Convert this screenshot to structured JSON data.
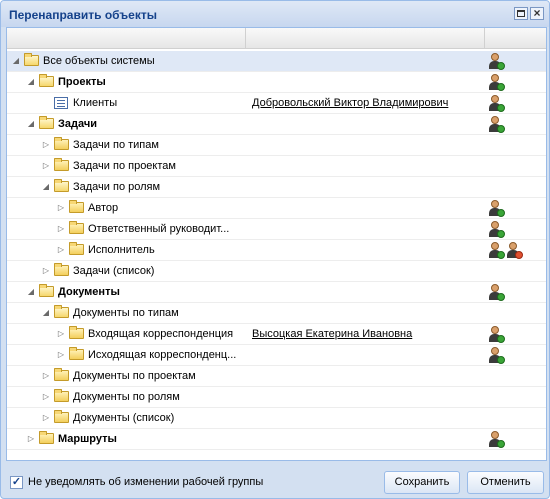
{
  "window": {
    "title": "Перенаправить объекты"
  },
  "tree": [
    {
      "label": "Все объекты системы",
      "bold": false,
      "arrow": "expanded",
      "icon": "folder-open",
      "level": 0,
      "selected": true,
      "users": [
        "add"
      ]
    },
    {
      "label": "Проекты",
      "bold": true,
      "arrow": "expanded",
      "icon": "folder-open",
      "level": 1,
      "users": [
        "add"
      ]
    },
    {
      "label": "Клиенты",
      "bold": false,
      "arrow": "none",
      "icon": "list",
      "level": 2,
      "link": "Добровольский Виктор Владимирович",
      "users": [
        "add"
      ]
    },
    {
      "label": "Задачи",
      "bold": true,
      "arrow": "expanded",
      "icon": "folder-open",
      "level": 1,
      "users": [
        "add"
      ]
    },
    {
      "label": "Задачи по типам",
      "bold": false,
      "arrow": "collapsed",
      "icon": "folder",
      "level": 2,
      "users": []
    },
    {
      "label": "Задачи по проектам",
      "bold": false,
      "arrow": "collapsed",
      "icon": "folder",
      "level": 2,
      "users": []
    },
    {
      "label": "Задачи по ролям",
      "bold": false,
      "arrow": "expanded",
      "icon": "folder-open",
      "level": 2,
      "users": []
    },
    {
      "label": "Автор",
      "bold": false,
      "arrow": "collapsed",
      "icon": "folder",
      "level": 3,
      "users": [
        "add"
      ]
    },
    {
      "label": "Ответственный руководит...",
      "bold": false,
      "arrow": "collapsed",
      "icon": "folder",
      "level": 3,
      "users": [
        "add"
      ]
    },
    {
      "label": "Исполнитель",
      "bold": false,
      "arrow": "collapsed",
      "icon": "folder",
      "level": 3,
      "users": [
        "add",
        "remove"
      ]
    },
    {
      "label": "Задачи (список)",
      "bold": false,
      "arrow": "collapsed",
      "icon": "folder",
      "level": 2,
      "users": []
    },
    {
      "label": "Документы",
      "bold": true,
      "arrow": "expanded",
      "icon": "folder-open",
      "level": 1,
      "users": [
        "add"
      ]
    },
    {
      "label": "Документы по типам",
      "bold": false,
      "arrow": "expanded",
      "icon": "folder-open",
      "level": 2,
      "users": []
    },
    {
      "label": "Входящая корреспонденция",
      "bold": false,
      "arrow": "collapsed",
      "icon": "folder",
      "level": 3,
      "link": "Высоцкая Екатерина Ивановна",
      "users": [
        "add"
      ]
    },
    {
      "label": "Исходящая корреспонденц...",
      "bold": false,
      "arrow": "collapsed",
      "icon": "folder",
      "level": 3,
      "users": [
        "add"
      ]
    },
    {
      "label": "Документы по проектам",
      "bold": false,
      "arrow": "collapsed",
      "icon": "folder",
      "level": 2,
      "users": []
    },
    {
      "label": "Документы по ролям",
      "bold": false,
      "arrow": "collapsed",
      "icon": "folder",
      "level": 2,
      "users": []
    },
    {
      "label": "Документы (список)",
      "bold": false,
      "arrow": "collapsed",
      "icon": "folder",
      "level": 2,
      "users": []
    },
    {
      "label": "Маршруты",
      "bold": true,
      "arrow": "collapsed",
      "icon": "folder",
      "level": 1,
      "users": [
        "add"
      ]
    }
  ],
  "footer": {
    "checkbox_label": "Не уведомлять об изменении рабочей группы",
    "checkbox_checked": "✓",
    "save_label": "Сохранить",
    "cancel_label": "Отменить"
  },
  "glyphs": {
    "close": "×",
    "expanded": "◢",
    "collapsed": "▷"
  }
}
